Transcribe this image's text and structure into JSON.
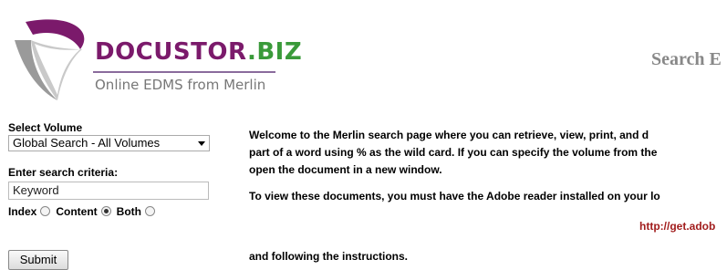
{
  "brand": {
    "name": "DOCUSTOR",
    "tld": ".BIZ",
    "tagline": "Online EDMS from Merlin"
  },
  "page": {
    "heading": "Search E"
  },
  "form": {
    "volume_label": "Select Volume",
    "volume_selected": "Global Search - All Volumes",
    "criteria_label": "Enter search criteria:",
    "criteria_value": "Keyword",
    "index_label": "Index",
    "content_label": "Content",
    "both_label": "Both",
    "selected_option": "Content",
    "submit_label": "Submit"
  },
  "main": {
    "line1": "Welcome to the Merlin search page where you can retrieve, view, print, and d",
    "line2": "part of a word using % as the wild card. If you can specify the volume from the",
    "line3": "open the document in a new window.",
    "line4": "To view these documents, you must have the Adobe reader installed on your lo",
    "link": "http://get.adob",
    "line5": "and following the instructions."
  }
}
